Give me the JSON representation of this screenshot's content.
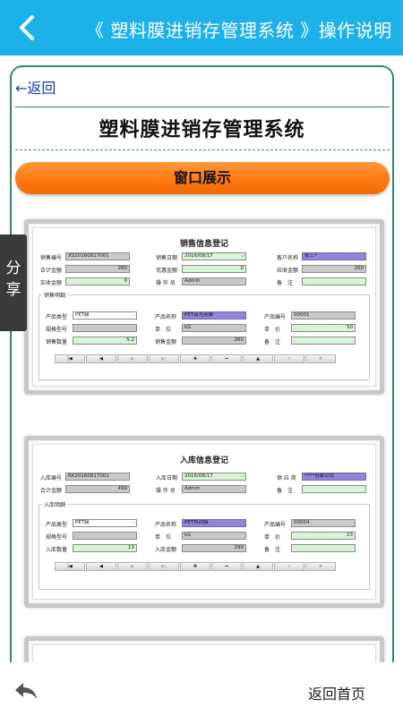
{
  "header": {
    "title": "《 塑料膜进销存管理系统 》操作说明"
  },
  "content": {
    "back_link": "←返回",
    "system_title": "塑料膜进销存管理系统",
    "section_button": "窗口展示"
  },
  "sales_form": {
    "title": "销售信息登记",
    "rows": [
      [
        {
          "label": "销售编号",
          "value": "XS20160817001"
        },
        {
          "label": "销售日期",
          "value": "2016/08/17"
        },
        {
          "label": "客户名称",
          "value": "张三*"
        }
      ],
      [
        {
          "label": "合计金额",
          "value": "260"
        },
        {
          "label": "优惠金额",
          "value": "0"
        },
        {
          "label": "应收金额",
          "value": "260"
        }
      ],
      [
        {
          "label": "实收金额",
          "value": "0"
        },
        {
          "label": "操 作 员",
          "value": "Admin"
        },
        {
          "label": "备　注",
          "value": ""
        }
      ]
    ],
    "group_label": "销售明细",
    "detail": [
      [
        {
          "label": "产品类型",
          "value": "PET膜"
        },
        {
          "label": "产品名称",
          "value": "PET高光亮膜"
        },
        {
          "label": "产品编号",
          "value": "00001"
        }
      ],
      [
        {
          "label": "规格型号",
          "value": ""
        },
        {
          "label": "单　位",
          "value": "kG"
        },
        {
          "label": "单　价",
          "value": "50"
        }
      ],
      [
        {
          "label": "销售数量",
          "value": "5.2"
        },
        {
          "label": "销售金额",
          "value": "260"
        },
        {
          "label": "备　注",
          "value": ""
        }
      ]
    ]
  },
  "stock_form": {
    "title": "入库信息登记",
    "rows": [
      [
        {
          "label": "入库编号",
          "value": "RK20160817001"
        },
        {
          "label": "入库日期",
          "value": "2016/08/17"
        },
        {
          "label": "供 应 商",
          "value": "****包装公司"
        }
      ],
      [
        {
          "label": "合计金额",
          "value": "499"
        },
        {
          "label": "操 作 员",
          "value": "Admin"
        },
        {
          "label": "备　注",
          "value": ""
        }
      ]
    ],
    "group_label": "入库明细",
    "detail": [
      [
        {
          "label": "产品类型",
          "value": "PET膜"
        },
        {
          "label": "产品名称",
          "value": "PET热封膜"
        },
        {
          "label": "产品编号",
          "value": "00004"
        }
      ],
      [
        {
          "label": "规格型号",
          "value": ""
        },
        {
          "label": "单　位",
          "value": "kG"
        },
        {
          "label": "单　价",
          "value": "23"
        }
      ],
      [
        {
          "label": "入库数量",
          "value": "13"
        },
        {
          "label": "入库金额",
          "value": "299"
        },
        {
          "label": "备　注",
          "value": ""
        }
      ]
    ]
  },
  "nav_buttons": [
    "|◀",
    "◀",
    "▶",
    "▶|",
    "✚",
    "━",
    "▲",
    "✔",
    "✖"
  ],
  "share_tab": {
    "line1": "分",
    "line2": "享"
  },
  "footer": {
    "home_label": "返回首页"
  },
  "colors": {
    "header": "#1db1e9",
    "frame": "#2e8b6c",
    "button": "#ff7a12",
    "link": "#1a3aa8"
  }
}
